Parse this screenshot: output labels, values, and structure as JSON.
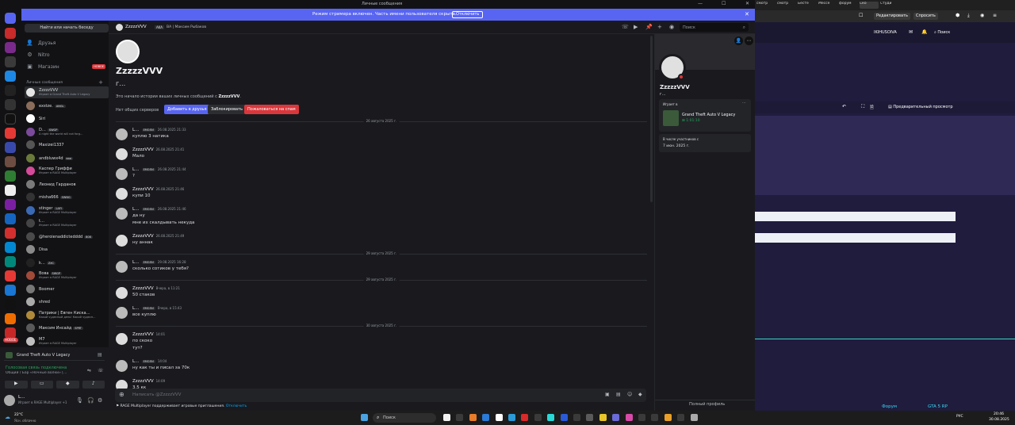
{
  "window": {
    "title": "Личные сообщения"
  },
  "streamer": {
    "text": "Режим стримера включен. Часть имени пользователя скрыта.",
    "button": "Отключить"
  },
  "sidebar": {
    "search_placeholder": "Найти или начать беседу",
    "nav": [
      {
        "label": "Друзья",
        "icon": "friends-icon"
      },
      {
        "label": "Nitro",
        "icon": "nitro-icon"
      },
      {
        "label": "Магазин",
        "icon": "shop-icon",
        "badge": "НОВОЕ"
      }
    ],
    "dm_header": "Личные сообщения",
    "dms": [
      {
        "name": "ZzzzzVVV",
        "sub": "Играет в Grand Theft Auto V Legacy",
        "color": "#e6e6e6",
        "active": true
      },
      {
        "name": "exstze.",
        "tag": "ANGL",
        "color": "#8a6d5a"
      },
      {
        "name": "Siri",
        "color": "#ffffff"
      },
      {
        "name": "D…",
        "tag": "SWGP",
        "sub": "A night the world will not forg…",
        "color": "#7b4a9a"
      },
      {
        "name": "Maxizei1337",
        "color": "#555"
      },
      {
        "name": "andbluwx4d",
        "tag": "ваа",
        "color": "#6a7a3a"
      },
      {
        "name": "Каспер Гриффи",
        "sub": "Играет в RAGE Multiplayer",
        "color": "#d64a9a"
      },
      {
        "name": "Леонид Гарданов",
        "color": "#7a7a7a"
      },
      {
        "name": "misha666",
        "tag": "SWNG",
        "color": "#333"
      },
      {
        "name": "stinger",
        "tag": "LAFI",
        "sub": "Играет в RAGE Multiplayer",
        "color": "#3a6ab5"
      },
      {
        "name": "t…",
        "sub": "Играет в RAGE Multiplayer",
        "color": "#444"
      },
      {
        "name": "@heroienaddictedddd",
        "tag": "808",
        "color": "#4a4a4a"
      },
      {
        "name": "Disa",
        "color": "#8a8a8a"
      },
      {
        "name": "k…",
        "tag": "ZXC",
        "color": "#222"
      },
      {
        "name": "Вова",
        "tag": "SWGP",
        "sub": "Играет в RAGE Multiplayer",
        "color": "#a04a3a"
      },
      {
        "name": "Boomer",
        "color": "#777"
      },
      {
        "name": "shred",
        "color": "#aaa"
      },
      {
        "name": "Патрики | Евген Киска…",
        "sub": "Какой чудесный день! Какой чудесн…",
        "color": "#b08a3a"
      },
      {
        "name": "Максим Инсайд",
        "tag": "SPRT",
        "color": "#5a5a5a"
      },
      {
        "name": "M7",
        "sub": "Играет в RAGE Multiplayer",
        "color": "#c0c0c0"
      }
    ],
    "game": {
      "title": "Grand Theft Auto V Legacy",
      "voice_status": "Голосовая связь подключена",
      "voice_channel": "Общий / Бар «Ночные волки» [..."
    },
    "user": {
      "name": "L…",
      "status": "Играет в RAGE Multiplayer +1"
    }
  },
  "header": {
    "username": "ZzzzzVVV",
    "aka": "AKA",
    "aka_names": "BA | Максим Рыбаков",
    "search_placeholder": "Поиск"
  },
  "intro": {
    "name": "ZzzzzVVV",
    "handle": "г…",
    "text_before": "Это начало истории ваших личных сообщений с ",
    "text_name": "ZzzzzVVV",
    "text_after": ".",
    "mutual": "Нет общих серверов",
    "btn_add": "Добавить в друзья",
    "btn_block": "Заблокировать",
    "btn_spam": "Пожаловаться на спам"
  },
  "messages": [
    {
      "type": "sep",
      "text": "26 августа 2025 г."
    },
    {
      "author": "L…",
      "tag": "ЕМОЛИ",
      "time": "26.08.2025 21:33",
      "lines": [
        "куплю 3 натика"
      ]
    },
    {
      "author": "ZzzzzVVV",
      "time": "26.08.2025 21:41",
      "lines": [
        "Мало"
      ]
    },
    {
      "author": "L…",
      "tag": "ЕМОЛИ",
      "time": "26.08.2025 21:44",
      "lines": [
        "?"
      ]
    },
    {
      "author": "ZzzzzVVV",
      "time": "26.08.2025 21:46",
      "lines": [
        "купи 10"
      ]
    },
    {
      "author": "L…",
      "tag": "ЕМОЛИ",
      "time": "26.08.2025 21:46",
      "lines": [
        "да ну",
        "мне их скалдывать некуда"
      ]
    },
    {
      "author": "ZzzzzVVV",
      "time": "26.08.2025 21:49",
      "lines": [
        "ну аннак"
      ]
    },
    {
      "type": "sep",
      "text": "29 августа 2025 г."
    },
    {
      "author": "L…",
      "tag": "ЕМОЛИ",
      "time": "29.08.2025 16:28",
      "lines": [
        "сколько сотиков у тебя?"
      ]
    },
    {
      "type": "sep",
      "text": "29 августа 2025 г."
    },
    {
      "author": "ZzzzzVVV",
      "time": "Вчера, в 11:21",
      "lines": [
        "50 стаков"
      ]
    },
    {
      "author": "L…",
      "tag": "ЕМОЛИ",
      "time": "Вчера, в 15:43",
      "lines": [
        "все куплю"
      ]
    },
    {
      "type": "sep",
      "text": "30 августа 2025 г."
    },
    {
      "author": "ZzzzzVVV",
      "time": "14:01",
      "lines": [
        "по скоко",
        "тут?"
      ]
    },
    {
      "author": "L…",
      "tag": "ЕМОЛИ",
      "time": "14:04",
      "lines": [
        "ну как ты и писал за 70к"
      ]
    },
    {
      "author": "ZzzzzVVV",
      "time": "14:09",
      "lines": [
        "3.5 кк"
      ]
    }
  ],
  "composer": {
    "placeholder": "Написать @ZzzzzVVV"
  },
  "rage_notice": {
    "text": "RAGE Multiplayer поддерживает игровые приглашения.",
    "link": "Отключить"
  },
  "profile": {
    "name": "ZzzzzVVV",
    "handle": "г…",
    "playing_header": "Играет в",
    "game": "Grand Theft Auto V Legacy",
    "elapsed": "1:01:10",
    "member_header": "В числе участников с",
    "member_since": "7 июн. 2025 г.",
    "full_profile": "Полный профиль"
  },
  "browser": {
    "tabs": [
      "смотр",
      "смотр",
      "Бесте",
      "Мессе",
      "форум",
      "Ско",
      "Студи"
    ],
    "user": "IKIHUSOIVA",
    "edit": "Редактировать",
    "ask": "Спросить",
    "search": "Поиск",
    "preview": "Предварительный просмотр",
    "forum": "Форум",
    "gta": "GTA 5 RP"
  },
  "taskbar": {
    "weather_temp": "22°C",
    "weather_desc": "Ясн. облачно",
    "search": "Поиск",
    "lang": "РУС",
    "time": "20:46",
    "date": "30.08.2025"
  }
}
